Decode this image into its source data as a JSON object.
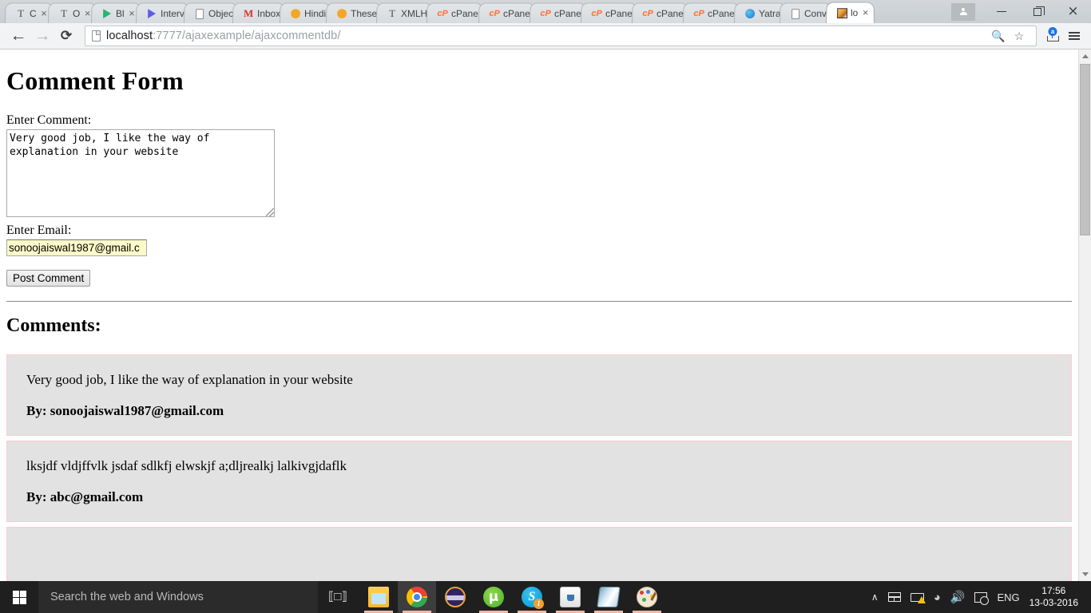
{
  "browser": {
    "tabs": [
      {
        "label": "C",
        "icon": "text-document-icon",
        "icon_kind": "t",
        "close": "×",
        "active": false
      },
      {
        "label": "O",
        "icon": "text-document-icon",
        "icon_kind": "t",
        "close": "×",
        "active": false
      },
      {
        "label": "Bl",
        "icon": "play-store-icon",
        "icon_kind": "play",
        "close": "×",
        "active": false
      },
      {
        "label": "Interv",
        "icon": "play-store-icon",
        "icon_kind": "play",
        "close": "",
        "active": false
      },
      {
        "label": "Objec",
        "icon": "page-icon",
        "icon_kind": "doc",
        "close": "",
        "active": false
      },
      {
        "label": "Inbox",
        "icon": "gmail-icon",
        "icon_kind": "gm",
        "close": "",
        "active": false
      },
      {
        "label": "Hindi",
        "icon": "orange-dot-icon",
        "icon_kind": "dot",
        "close": "",
        "active": false
      },
      {
        "label": "These",
        "icon": "orange-dot-icon",
        "icon_kind": "dot",
        "close": "",
        "active": false
      },
      {
        "label": "XMLH",
        "icon": "text-document-icon",
        "icon_kind": "t",
        "close": "",
        "active": false
      },
      {
        "label": "cPane",
        "icon": "cpanel-icon",
        "icon_kind": "cp",
        "close": "",
        "active": false
      },
      {
        "label": "cPane",
        "icon": "cpanel-icon",
        "icon_kind": "cp",
        "close": "",
        "active": false
      },
      {
        "label": "cPane",
        "icon": "cpanel-icon",
        "icon_kind": "cp",
        "close": "",
        "active": false
      },
      {
        "label": "cPane",
        "icon": "cpanel-icon",
        "icon_kind": "cp",
        "close": "",
        "active": false
      },
      {
        "label": "cPane",
        "icon": "cpanel-icon",
        "icon_kind": "cp",
        "close": "",
        "active": false
      },
      {
        "label": "cPane",
        "icon": "cpanel-icon",
        "icon_kind": "cp",
        "close": "",
        "active": false
      },
      {
        "label": "Yatra",
        "icon": "yatra-icon",
        "icon_kind": "yatra",
        "close": "",
        "active": false
      },
      {
        "label": "Conv",
        "icon": "page-icon",
        "icon_kind": "doc",
        "close": "",
        "active": false
      },
      {
        "label": "lo",
        "icon": "localhost-favicon",
        "icon_kind": "img",
        "close": "×",
        "active": true
      }
    ],
    "window_controls": {
      "profile": "profile-icon",
      "minimize": "minimize-button",
      "maximize": "maximize-button",
      "close": "×"
    },
    "toolbar": {
      "back": "←",
      "forward": "→",
      "reload": "⟳",
      "url_host": "localhost",
      "url_rest": ":7777/ajaxexample/ajaxcommentdb/",
      "zoom_icon": "zoom-in-icon",
      "bookmark_icon": "☆",
      "extension_badge": "a",
      "menu_icon": "hamburger-menu-icon"
    }
  },
  "page": {
    "title": "Comment Form",
    "comment_label": "Enter Comment:",
    "comment_value": "Very good job, I like the way of explanation in your website",
    "email_label": "Enter Email:",
    "email_value": "sonoojaiswal1987@gmail.c",
    "post_button": "Post Comment",
    "comments_heading": "Comments:",
    "comments": [
      {
        "text": "Very good job, I like the way of explanation in your website",
        "by": "By: sonoojaiswal1987@gmail.com"
      },
      {
        "text": "lksjdf vldjffvlk jsdaf sdlkfj elwskjf a;dljrealkj lalkivgjdaflk",
        "by": "By: abc@gmail.com"
      }
    ]
  },
  "taskbar": {
    "start": "windows-start-icon",
    "search_placeholder": "Search the web and Windows",
    "taskview": "task-view-icon",
    "apps": [
      {
        "name": "file-explorer",
        "active": false,
        "badge": ""
      },
      {
        "name": "google-chrome",
        "active": true,
        "badge": ""
      },
      {
        "name": "eclipse",
        "active": false,
        "badge": ""
      },
      {
        "name": "utorrent",
        "active": false,
        "badge": "µ"
      },
      {
        "name": "skype",
        "active": false,
        "badge": "1"
      },
      {
        "name": "java",
        "active": false,
        "badge": ""
      },
      {
        "name": "notepad",
        "active": false,
        "badge": ""
      },
      {
        "name": "paint",
        "active": false,
        "badge": ""
      }
    ],
    "tray": {
      "chevron": "∧",
      "language": "ENG",
      "time": "17:56",
      "date": "13-03-2016"
    }
  },
  "colors": {
    "comment_box_bg": "#e2e2e2",
    "comment_box_border": "#ffc9d2",
    "autofill_yellow": "#fbfbc9",
    "taskbar_bg": "#1f1f1f",
    "chrome_toolbar": "#f1f3f4"
  }
}
